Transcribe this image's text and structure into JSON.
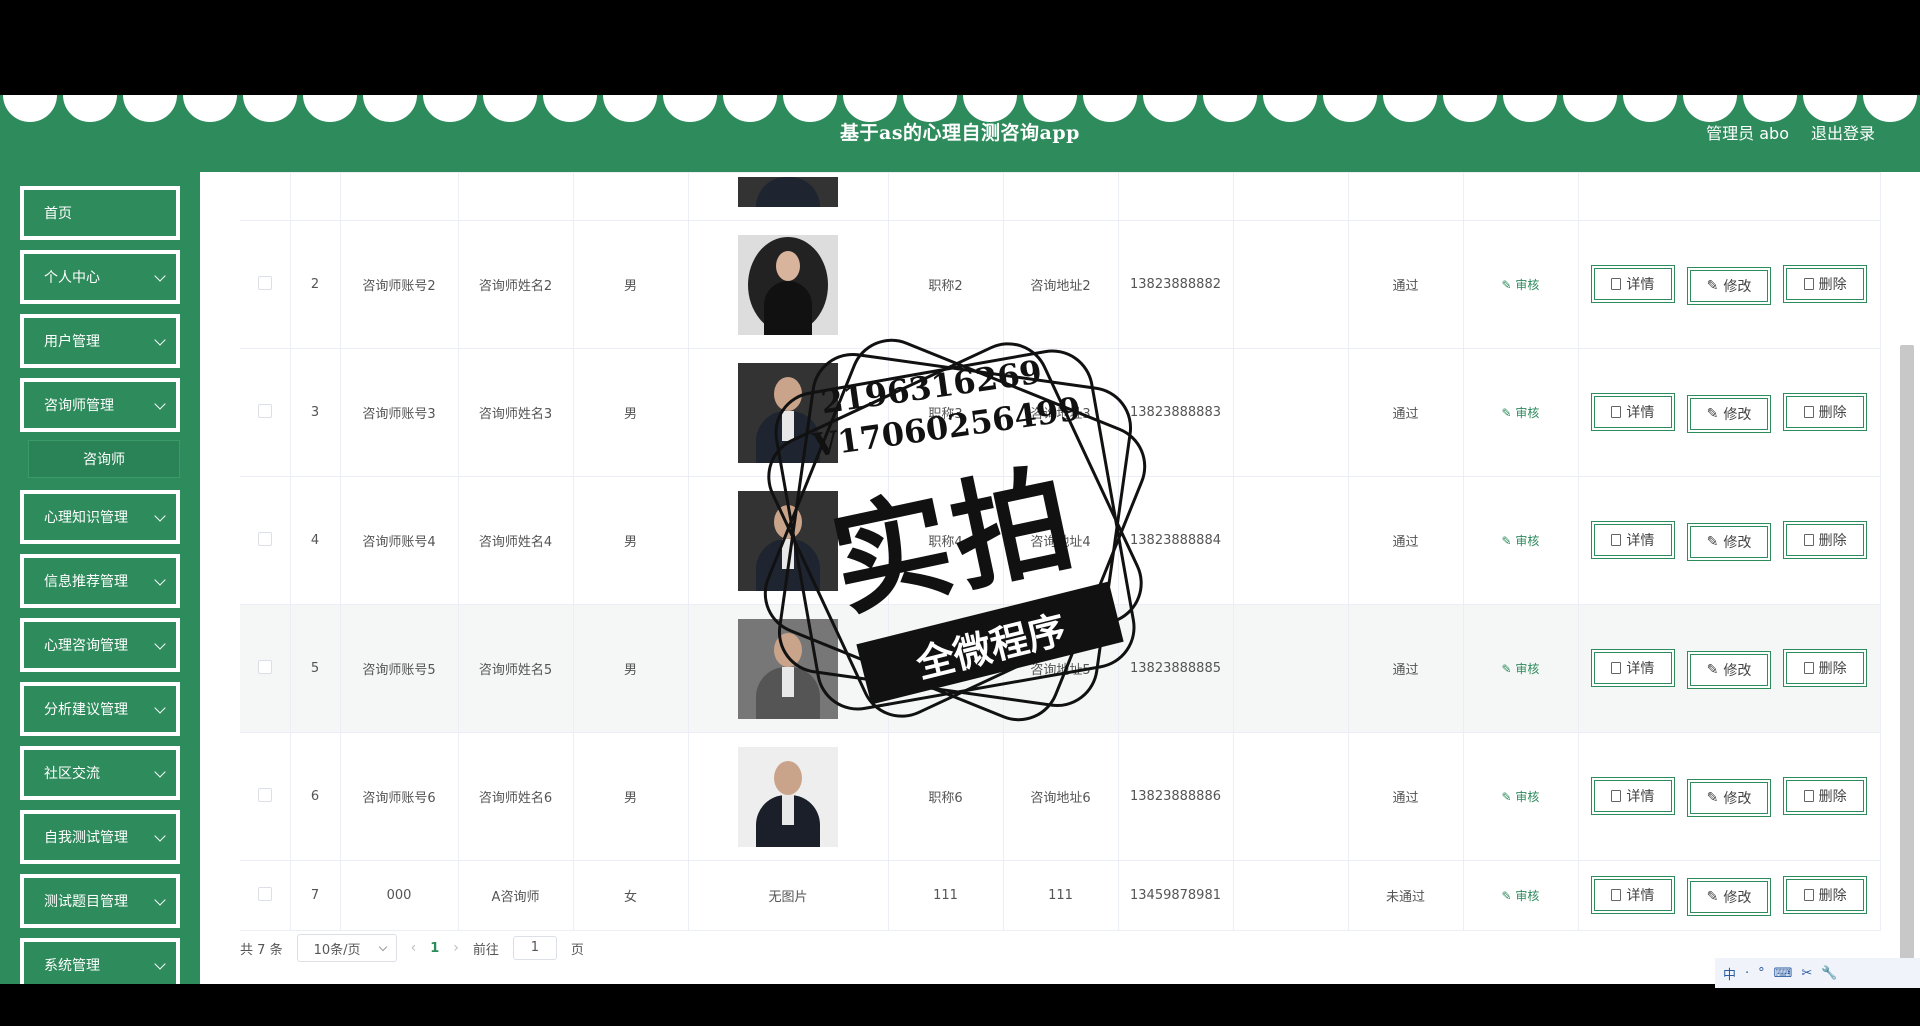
{
  "header": {
    "title": "基于as的心理自测咨询app",
    "user_label": "管理员 abo",
    "logout": "退出登录"
  },
  "sidebar": {
    "items": [
      {
        "label": "首页",
        "has_arrow": false
      },
      {
        "label": "个人中心",
        "has_arrow": true
      },
      {
        "label": "用户管理",
        "has_arrow": true
      },
      {
        "label": "咨询师管理",
        "has_arrow": true
      },
      {
        "label": "心理知识管理",
        "has_arrow": true
      },
      {
        "label": "信息推荐管理",
        "has_arrow": true
      },
      {
        "label": "心理咨询管理",
        "has_arrow": true
      },
      {
        "label": "分析建议管理",
        "has_arrow": true
      },
      {
        "label": "社区交流",
        "has_arrow": true
      },
      {
        "label": "自我测试管理",
        "has_arrow": true
      },
      {
        "label": "测试题目管理",
        "has_arrow": true
      },
      {
        "label": "系统管理",
        "has_arrow": true
      }
    ],
    "submenu_active": "咨询师"
  },
  "table": {
    "rows": [
      {
        "index": "2",
        "account": "咨询师账号2",
        "name": "咨询师姓名2",
        "gender": "男",
        "photo": "avatar-woman",
        "title": "职称2",
        "address": "咨询地址2",
        "phone": "13823888882",
        "status": "通过"
      },
      {
        "index": "3",
        "account": "咨询师账号3",
        "name": "咨询师姓名3",
        "gender": "男",
        "photo": "avatar-man",
        "title": "职称3",
        "address": "咨询地址3",
        "phone": "13823888883",
        "status": "通过"
      },
      {
        "index": "4",
        "account": "咨询师账号4",
        "name": "咨询师姓名4",
        "gender": "男",
        "photo": "avatar-man",
        "title": "职称4",
        "address": "咨询地址4",
        "phone": "13823888884",
        "status": "通过"
      },
      {
        "index": "5",
        "account": "咨询师账号5",
        "name": "咨询师姓名5",
        "gender": "男",
        "photo": "avatar-man",
        "title": "职称5",
        "address": "咨询地址5",
        "phone": "13823888885",
        "status": "通过"
      },
      {
        "index": "6",
        "account": "咨询师账号6",
        "name": "咨询师姓名6",
        "gender": "男",
        "photo": "avatar-man",
        "title": "职称6",
        "address": "咨询地址6",
        "phone": "13823888886",
        "status": "通过"
      },
      {
        "index": "7",
        "account": "000",
        "name": "A咨询师",
        "gender": "女",
        "photo_text": "无图片",
        "title": "111",
        "address": "111",
        "phone": "13459878981",
        "status": "未通过"
      }
    ],
    "action_audit": "审核",
    "btn_detail": "详情",
    "btn_edit": "修改",
    "btn_delete": "删除"
  },
  "pagination": {
    "total_prefix": "共",
    "total": "7",
    "total_suffix": "条",
    "page_size": "10条/页",
    "prev": "‹",
    "current_page": "1",
    "next": "›",
    "goto_prefix": "前往",
    "goto_value": "1",
    "goto_suffix": "页"
  },
  "watermark": {
    "line1": "2196316269",
    "line2": "V17060256499",
    "big": "实拍",
    "banner": "全微程序"
  },
  "tray": {
    "items": [
      "中",
      "·",
      "°",
      "⌨",
      "✂",
      "🔧"
    ]
  },
  "colors": {
    "brand": "#2e8b5c",
    "link": "#2e8b5c"
  }
}
